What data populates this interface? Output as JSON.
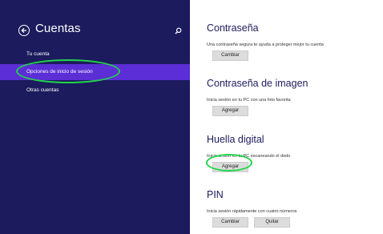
{
  "sidebar": {
    "title": "Cuentas",
    "items": [
      {
        "label": "Tu cuenta"
      },
      {
        "label": "Opciones de inicio de sesión"
      },
      {
        "label": "Otras cuentas"
      }
    ],
    "selected_index": 1,
    "colors": {
      "background": "#1c1b5d",
      "selected": "#5c2ed6"
    }
  },
  "icons": {
    "back": "back-arrow-icon",
    "search": "search-icon"
  },
  "sections": [
    {
      "heading": "Contraseña",
      "description": "Una contraseña segura te ayuda a proteger mejor tu cuenta",
      "buttons": [
        "Cambiar"
      ]
    },
    {
      "heading": "Contraseña de imagen",
      "description": "Inicia sesión en tu PC con una foto favorita",
      "buttons": [
        "Agregar"
      ]
    },
    {
      "heading": "Huella digital",
      "description": "Inicia sesión en tu PC escaneando el dedo",
      "buttons": [
        "Agregar"
      ]
    },
    {
      "heading": "PIN",
      "description": "Inicia sesión rápidamente con cuatro números",
      "buttons": [
        "Cambiar",
        "Quitar"
      ]
    }
  ],
  "annotation_color": "#22d64a"
}
